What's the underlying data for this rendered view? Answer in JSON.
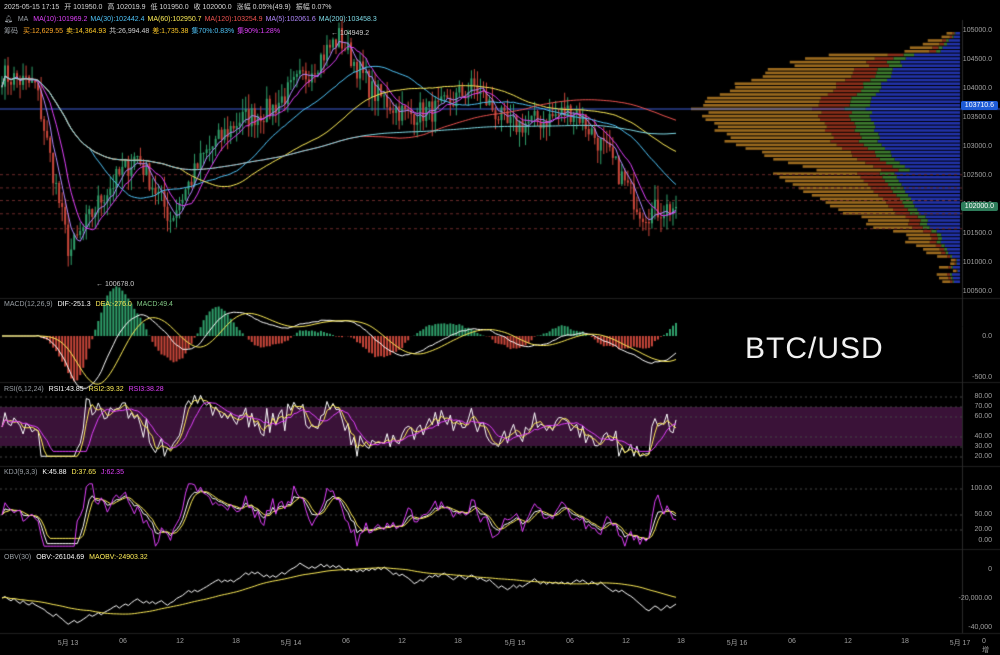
{
  "header": {
    "datetime": "2025-05-15 17:15",
    "open": "开 101950.0",
    "high": "高 102019.9",
    "low": "低 101950.0",
    "close": "收 102000.0",
    "change": "涨幅 0.05%(49.9)",
    "amplitude": "振幅 0.07%"
  },
  "ma_line": {
    "label": "MA",
    "items": [
      {
        "text": "MA(10):101969.2",
        "color": "#e040fb"
      },
      {
        "text": "MA(30):102442.4",
        "color": "#4fc3f7"
      },
      {
        "text": "MA(60):102950.7",
        "color": "#ffee58"
      },
      {
        "text": "MA(120):103254.9",
        "color": "#ef5350"
      },
      {
        "text": "MA(5):102061.6",
        "color": "#b388ff"
      },
      {
        "text": "MA(200):103458.3",
        "color": "#80deea"
      }
    ]
  },
  "chip_line": {
    "label": "筹码",
    "items": [
      {
        "text": "买:12,629.55",
        "color": "#ffa726"
      },
      {
        "text": "卖:14,364.93",
        "color": "#ffca28"
      },
      {
        "text": "共:26,994.48",
        "color": "#cfcfcf"
      },
      {
        "text": "差:1,735.38",
        "color": "#ffca28"
      },
      {
        "text": "集70%:0.83%",
        "color": "#4fc3f7"
      },
      {
        "text": "集90%:1.28%",
        "color": "#e040fb"
      }
    ]
  },
  "annotations": {
    "high": "← 104949.2",
    "low": "← 100678.0"
  },
  "watermark": "BTC/USD",
  "price_axis": [
    "105000.0",
    "104500.0",
    "104000.0",
    "103500.0",
    "103000.0",
    "102500.0",
    "102000.0",
    "101500.0",
    "101000.0",
    "100500.0"
  ],
  "price_tags": {
    "upper": "103710.6",
    "current": "102000.0"
  },
  "macd": {
    "title": "MACD(12,26,9)",
    "dif": "DIF:-251.3",
    "dea": "DEA:-276.0",
    "macd": "MACD:49.4",
    "axis": [
      "0.0",
      "-500.0"
    ]
  },
  "rsi": {
    "title": "RSI(6,12,24)",
    "rsi1": "RSI1:43.85",
    "rsi2": "RSI2:39.32",
    "rsi3": "RSI3:38.28",
    "axis": [
      "80.00",
      "70.00",
      "60.00",
      "40.00",
      "30.00",
      "20.00"
    ]
  },
  "kdj": {
    "title": "KDJ(9,3,3)",
    "k": "K:45.88",
    "d": "D:37.65",
    "j": "J:62.35",
    "axis": [
      "100.00",
      "50.00",
      "20.00",
      "0.00"
    ]
  },
  "obv": {
    "title": "OBV(30)",
    "obv": "OBV:-26104.69",
    "maobv": "MAOBV:-24903.32",
    "axis": [
      "0",
      "-20,000.00",
      "-40,000"
    ]
  },
  "x_axis": [
    "5月 13",
    "06",
    "12",
    "18",
    "5月 14",
    "06",
    "12",
    "18",
    "5月 15",
    "06",
    "12",
    "18",
    "5月 16",
    "06",
    "12",
    "18",
    "5月 17",
    "0 增"
  ],
  "chart_data": {
    "type": "candlestick",
    "symbol": "BTC/USD",
    "interval": "15m",
    "ylim": [
      100500,
      105100
    ],
    "current_price": 102000.0,
    "marked_price": 103710.6,
    "series_close_approx": [
      {
        "x": "5月 13 00:00",
        "y": 104300
      },
      {
        "x": "5月 13 03:00",
        "y": 104100
      },
      {
        "x": "5月 13 05:00",
        "y": 101200
      },
      {
        "x": "5月 13 06:00",
        "y": 102200
      },
      {
        "x": "5月 13 09:00",
        "y": 102900
      },
      {
        "x": "5月 13 12:00",
        "y": 101800
      },
      {
        "x": "5月 13 15:00",
        "y": 102900
      },
      {
        "x": "5月 13 18:00",
        "y": 103500
      },
      {
        "x": "5月 13 21:00",
        "y": 103700
      },
      {
        "x": "5月 14 00:00",
        "y": 104300
      },
      {
        "x": "5月 14 02:00",
        "y": 104949
      },
      {
        "x": "5月 14 06:00",
        "y": 104000
      },
      {
        "x": "5月 14 12:00",
        "y": 103600
      },
      {
        "x": "5月 14 18:00",
        "y": 103700
      },
      {
        "x": "5月 14 21:00",
        "y": 104100
      },
      {
        "x": "5月 15 00:00",
        "y": 103400
      },
      {
        "x": "5月 15 06:00",
        "y": 103500
      },
      {
        "x": "5月 15 09:00",
        "y": 103700
      },
      {
        "x": "5月 15 12:00",
        "y": 102900
      },
      {
        "x": "5月 15 15:00",
        "y": 101900
      },
      {
        "x": "5月 15 17:15",
        "y": 102000
      }
    ],
    "high_marker": 104949.2,
    "low_marker": 100678.0
  }
}
